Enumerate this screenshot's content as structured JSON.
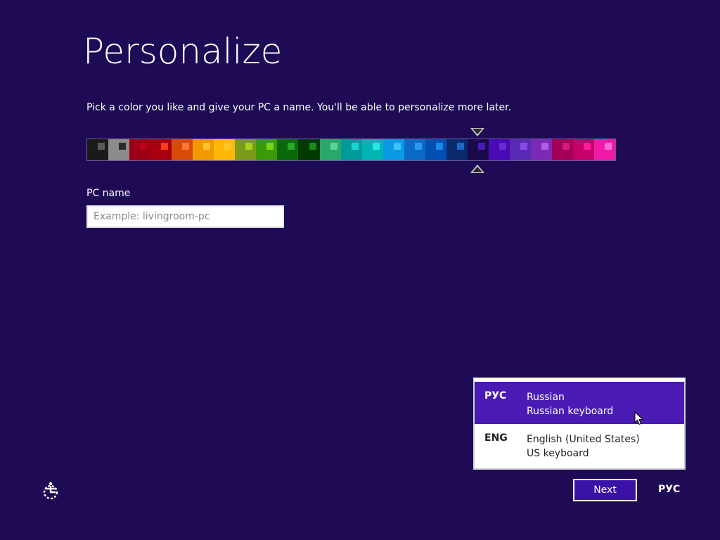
{
  "page": {
    "title": "Personalize",
    "instruction": "Pick a color you like and give your PC a name. You'll be able to personalize more later."
  },
  "color_picker": {
    "selected_index": 18,
    "swatches": [
      {
        "bg": "#1a1a1a",
        "inner": "#5a5a5a",
        "pos": "right"
      },
      {
        "bg": "#8c8c8c",
        "inner": "#2a2a2a",
        "pos": "right"
      },
      {
        "bg": "#9c0014",
        "inner": "#c0001a",
        "pos": "right"
      },
      {
        "bg": "#a80010",
        "inner": "#ff3a1a",
        "pos": "right"
      },
      {
        "bg": "#d84a0a",
        "inner": "#ff7a2a",
        "pos": "right"
      },
      {
        "bg": "#f09a00",
        "inner": "#ffc030",
        "pos": "right"
      },
      {
        "bg": "#ffb80a",
        "inner": "#ffc82a",
        "pos": "right"
      },
      {
        "bg": "#7a9a1a",
        "inner": "#a6d41a",
        "pos": "right"
      },
      {
        "bg": "#3a9a0a",
        "inner": "#7ad41a",
        "pos": "right"
      },
      {
        "bg": "#0a6a0a",
        "inner": "#2aa82a",
        "pos": "right"
      },
      {
        "bg": "#003a00",
        "inner": "#1a8a1a",
        "pos": "right"
      },
      {
        "bg": "#2aa86a",
        "inner": "#5ad49a",
        "pos": "right"
      },
      {
        "bg": "#009a9a",
        "inner": "#1ad4d4",
        "pos": "right"
      },
      {
        "bg": "#00b4b4",
        "inner": "#2ae6e6",
        "pos": "right"
      },
      {
        "bg": "#0a9ae6",
        "inner": "#3ac4ff",
        "pos": "right"
      },
      {
        "bg": "#0a6ac4",
        "inner": "#2a9af0",
        "pos": "right"
      },
      {
        "bg": "#0050b4",
        "inner": "#1a8ae6",
        "pos": "right"
      },
      {
        "bg": "#0a2a6a",
        "inner": "#1a6ac4",
        "pos": "right"
      },
      {
        "bg": "#1a0a4a",
        "inner": "#4a1ab4",
        "pos": "right"
      },
      {
        "bg": "#4a0ab4",
        "inner": "#6a2ad4",
        "pos": "right"
      },
      {
        "bg": "#5a2ab4",
        "inner": "#8a4ae6",
        "pos": "right"
      },
      {
        "bg": "#7a2ab4",
        "inner": "#b45ae6",
        "pos": "right"
      },
      {
        "bg": "#a4005a",
        "inner": "#d41a7a",
        "pos": "right"
      },
      {
        "bg": "#c4006a",
        "inner": "#ff1a9a",
        "pos": "right"
      },
      {
        "bg": "#f01aa8",
        "inner": "#ff6ad4",
        "pos": "right"
      }
    ]
  },
  "pc_name": {
    "label": "PC name",
    "placeholder": "Example: livingroom-pc",
    "value": ""
  },
  "language_popup": {
    "items": [
      {
        "code": "РУС",
        "language": "Russian",
        "keyboard": "Russian keyboard",
        "selected": true
      },
      {
        "code": "ENG",
        "language": "English (United States)",
        "keyboard": "US keyboard",
        "selected": false
      }
    ]
  },
  "footer": {
    "next_label": "Next",
    "language_indicator": "РУС"
  },
  "icons": {
    "ease_of_access": "ease-of-access-icon",
    "cursor": "mouse-pointer-icon"
  },
  "colors": {
    "background": "#1e0a55",
    "selected_item": "#4a1bb4",
    "button": "#3a12a6"
  }
}
